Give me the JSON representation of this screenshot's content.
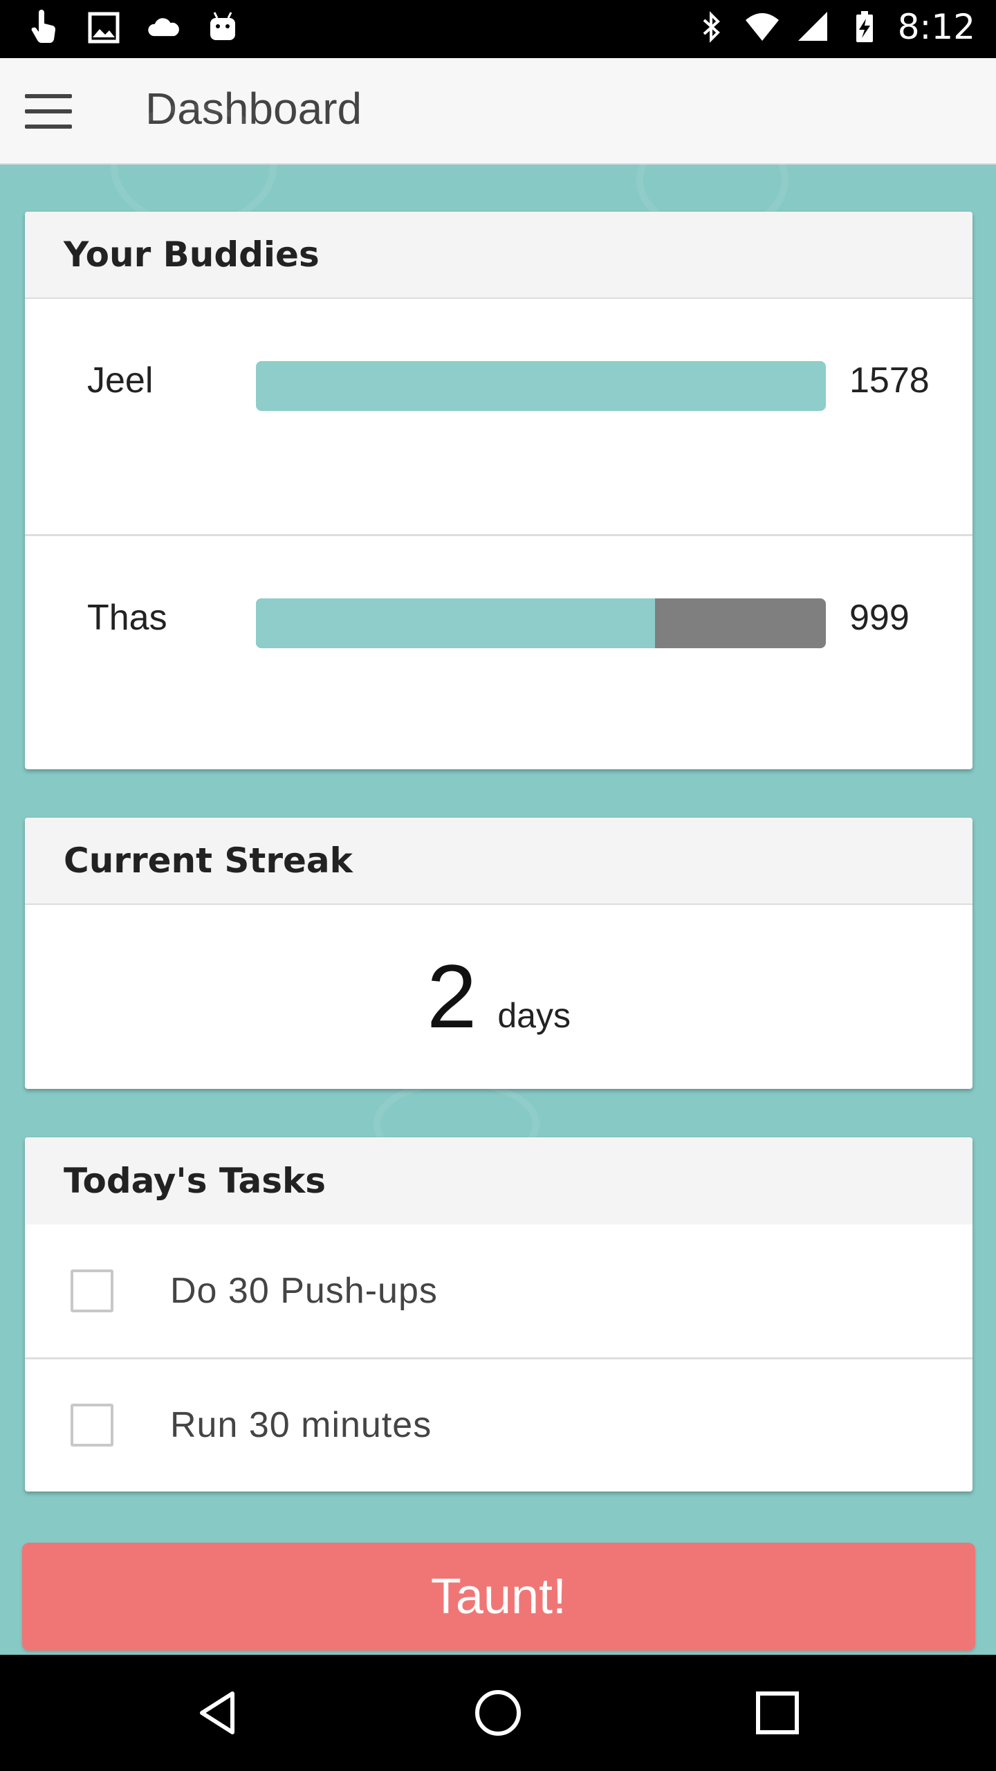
{
  "status_bar": {
    "time": "8:12",
    "left_icons": [
      "touch-icon",
      "image-icon",
      "cloud-icon",
      "android-icon"
    ],
    "right_icons": [
      "bluetooth-icon",
      "wifi-icon",
      "signal-icon",
      "battery-charging-icon"
    ]
  },
  "app_bar": {
    "menu_icon": "hamburger-menu-icon",
    "title": "Dashboard"
  },
  "buddies": {
    "title": "Your Buddies",
    "items": [
      {
        "name": "Jeel",
        "score": "1578",
        "progress": 1.0
      },
      {
        "name": "Thas",
        "score": "999",
        "progress": 0.7
      }
    ]
  },
  "streak": {
    "title": "Current Streak",
    "value": "2",
    "unit": "days"
  },
  "tasks": {
    "title": "Today's Tasks",
    "items": [
      {
        "label": "Do 30 Push-ups",
        "checked": false
      },
      {
        "label": "Run 30 minutes",
        "checked": false
      }
    ]
  },
  "taunt_button": {
    "label": "Taunt!"
  },
  "nav_bar": {
    "icons": [
      "back-icon",
      "home-icon",
      "recents-icon"
    ]
  },
  "colors": {
    "background": "#87c9c5",
    "progress_fill": "#8ecdc9",
    "progress_track": "#7f7f7f",
    "taunt": "#f07676"
  }
}
